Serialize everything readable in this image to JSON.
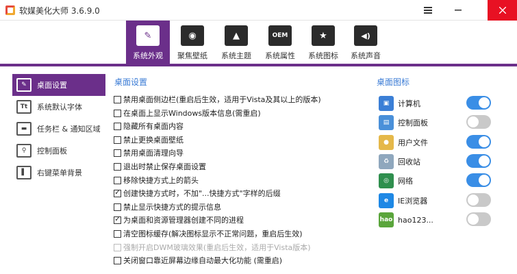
{
  "window": {
    "title": "软媒美化大师 3.6.9.0"
  },
  "top_tabs": [
    {
      "label": "系统外观",
      "icon": "brush-icon",
      "active": true
    },
    {
      "label": "聚焦壁纸",
      "icon": "camera-icon",
      "active": false
    },
    {
      "label": "系统主题",
      "icon": "tshirt-icon",
      "active": false
    },
    {
      "label": "系统属性",
      "icon": "oem-icon",
      "active": false
    },
    {
      "label": "系统图标",
      "icon": "star-icon",
      "active": false
    },
    {
      "label": "系统声音",
      "icon": "speaker-icon",
      "active": false
    }
  ],
  "top_tab_glyphs": [
    "✎",
    "◉",
    "▲",
    "OEM",
    "★",
    "◀)"
  ],
  "sidebar": {
    "items": [
      {
        "label": "桌面设置",
        "icon": "desktop-brush-icon",
        "glyph": "✎",
        "active": true
      },
      {
        "label": "系统默认字体",
        "icon": "font-icon",
        "glyph": "Tt",
        "active": false
      },
      {
        "label": "任务栏 & 通知区域",
        "icon": "taskbar-icon",
        "glyph": "▬",
        "active": false
      },
      {
        "label": "控制面板",
        "icon": "search-panel-icon",
        "glyph": "⚲",
        "active": false
      },
      {
        "label": "右键菜单背景",
        "icon": "context-menu-icon",
        "glyph": "▌",
        "active": false
      }
    ]
  },
  "desktop_settings": {
    "title": "桌面设置",
    "options": [
      {
        "label": "禁用桌面侧边栏(重启后生效，适用于Vista及其以上的版本)",
        "checked": false,
        "disabled": false
      },
      {
        "label": "在桌面上显示Windows版本信息(需重启)",
        "checked": false,
        "disabled": false
      },
      {
        "label": "隐藏所有桌面内容",
        "checked": false,
        "disabled": false
      },
      {
        "label": "禁止更换桌面壁纸",
        "checked": false,
        "disabled": false
      },
      {
        "label": "禁用桌面清理向导",
        "checked": false,
        "disabled": false
      },
      {
        "label": "退出时禁止保存桌面设置",
        "checked": false,
        "disabled": false
      },
      {
        "label": "移除快捷方式上的箭头",
        "checked": false,
        "disabled": false
      },
      {
        "label": "创建快捷方式时，不加\"...快捷方式\"字样的后缀",
        "checked": true,
        "disabled": false
      },
      {
        "label": "禁止显示快捷方式的提示信息",
        "checked": false,
        "disabled": false
      },
      {
        "label": "为桌面和资源管理器创建不同的进程",
        "checked": true,
        "disabled": false
      },
      {
        "label": "清空图标缓存(解决图标显示不正常问题，重启后生效)",
        "checked": false,
        "disabled": false
      },
      {
        "label": "强制开启DWM玻璃效果(重启后生效，适用于Vista版本)",
        "checked": false,
        "disabled": true
      },
      {
        "label": "关闭窗口靠近屏幕边缘自动最大化功能 (需重启)",
        "checked": false,
        "disabled": false
      }
    ]
  },
  "desktop_icons": {
    "title": "桌面图标",
    "items": [
      {
        "label": "计算机",
        "icon": "computer-icon",
        "glyph": "▣",
        "color": "#3b7fd6",
        "enabled": true
      },
      {
        "label": "控制面板",
        "icon": "control-panel-icon",
        "glyph": "▤",
        "color": "#4a90d9",
        "enabled": false
      },
      {
        "label": "用户文件",
        "icon": "user-folder-icon",
        "glyph": "●",
        "color": "#e5b84a",
        "enabled": true
      },
      {
        "label": "回收站",
        "icon": "recycle-bin-icon",
        "glyph": "♻",
        "color": "#8fa7bd",
        "enabled": true
      },
      {
        "label": "网络",
        "icon": "network-icon",
        "glyph": "◎",
        "color": "#2f8f4e",
        "enabled": true
      },
      {
        "label": "IE浏览器",
        "icon": "ie-browser-icon",
        "glyph": "e",
        "color": "#1e88e5",
        "enabled": false
      },
      {
        "label": "hao123...",
        "icon": "hao123-icon",
        "glyph": "hao",
        "color": "#5aa53b",
        "enabled": false
      }
    ]
  },
  "colors": {
    "accent": "#6b2f8a",
    "toggle_on": "#3a8ee6",
    "toggle_off": "#c9c9c9",
    "section_title": "#3a7bd5",
    "close_button": "#e81123"
  }
}
